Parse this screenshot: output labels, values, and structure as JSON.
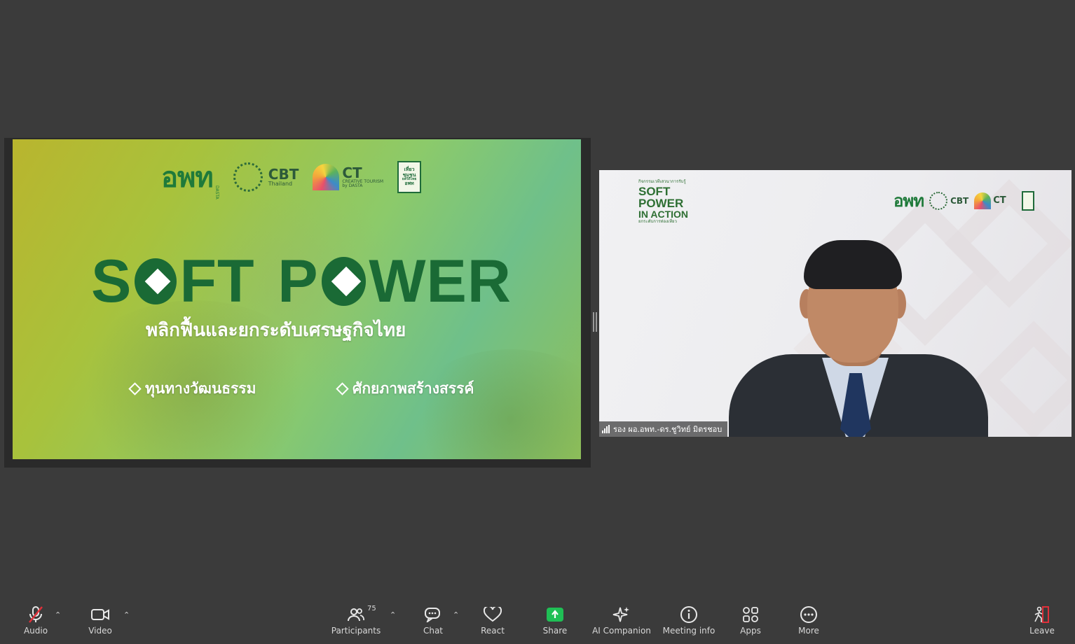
{
  "shared_screen": {
    "logos": {
      "own": "อพท",
      "own_tag": "DASTA",
      "cbt": "CBT",
      "cbt_sub": "Thailand",
      "ct": "CT",
      "ct_sub": "CREATIVE TOURISM",
      "ct_by": "by DASTA",
      "trip_line1": "เที่ยว",
      "trip_line2": "ชุมชน",
      "trip_line3": "ยลวิถีไทย",
      "trip_line4": "อพท"
    },
    "title_s": "S",
    "title_ft": "FT",
    "title_p": "P",
    "title_wer": "WER",
    "subtitle": "พลิกฟื้นและยกระดับเศรษฐกิจไทย",
    "pillars": [
      "ทุนทางวัฒนธรรม",
      "ศักยภาพสร้างสรรค์"
    ]
  },
  "video_tile": {
    "event_kicker": "กิจกรรมเวทีเสวนาการรับรู้",
    "event_line1": "SOFT",
    "event_line2": "POWER",
    "event_line3": "IN ACTION",
    "event_footer": "ยกระดับการท่องเที่ยว",
    "logo_own": "อพท",
    "logo_cbt": "CBT",
    "logo_ct": "CT",
    "participant_name": "รอง ผอ.อพท.-ดร.ชูวิทย์ มิตรชอบ"
  },
  "toolbar": {
    "audio": "Audio",
    "video": "Video",
    "participants": "Participants",
    "participants_count": "75",
    "chat": "Chat",
    "react": "React",
    "share": "Share",
    "ai_companion": "AI Companion",
    "meeting_info": "Meeting info",
    "apps": "Apps",
    "more": "More",
    "leave": "Leave"
  },
  "colors": {
    "background": "#3b3b3b",
    "slide_green": "#1a6a35",
    "share_green": "#1fbf55",
    "leave_red": "#e0303a",
    "mute_red": "#e0303a"
  },
  "icons": [
    "microphone-muted-icon",
    "camera-icon",
    "participants-icon",
    "chat-icon",
    "heart-icon",
    "share-screen-icon",
    "ai-sparkle-icon",
    "info-icon",
    "apps-icon",
    "more-icon",
    "leave-icon",
    "signal-icon"
  ]
}
